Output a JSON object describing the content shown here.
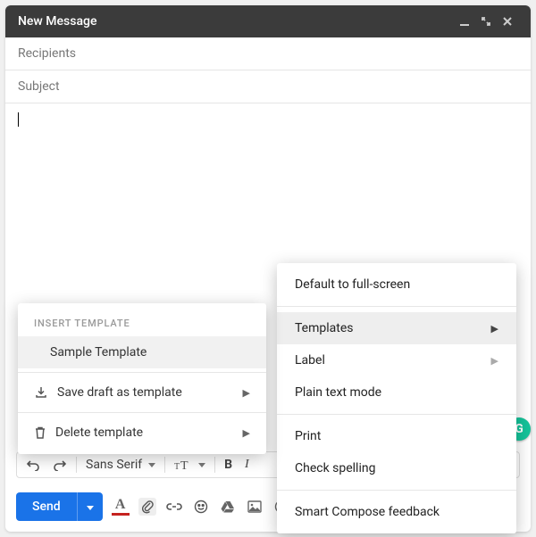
{
  "header": {
    "title": "New Message"
  },
  "fields": {
    "recipients_placeholder": "Recipients",
    "subject_placeholder": "Subject"
  },
  "format_toolbar": {
    "font": "Sans Serif"
  },
  "send": {
    "label": "Send"
  },
  "options_menu": {
    "default_fullscreen": "Default to full-screen",
    "templates": "Templates",
    "label": "Label",
    "plain_text": "Plain text mode",
    "print": "Print",
    "check_spelling": "Check spelling",
    "smart_compose": "Smart Compose feedback"
  },
  "template_submenu": {
    "header": "INSERT TEMPLATE",
    "sample": "Sample Template",
    "save_draft": "Save draft as template",
    "delete": "Delete template"
  },
  "grammarly": {
    "label": "G"
  }
}
